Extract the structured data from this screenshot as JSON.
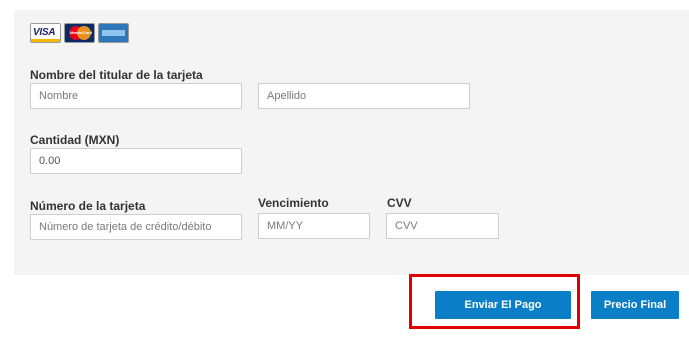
{
  "payment_cards": [
    "visa-icon",
    "mastercard-icon",
    "amex-icon"
  ],
  "card_labels": {
    "visa": "VISA",
    "mastercard": "MasterCard"
  },
  "cardholder": {
    "label": "Nombre del titular de la tarjeta",
    "first_name_placeholder": "Nombre",
    "last_name_placeholder": "Apellido"
  },
  "amount": {
    "label": "Cantidad (MXN)",
    "value": "0.00"
  },
  "card_number": {
    "label": "Número de la tarjeta",
    "placeholder": "Número de tarjeta de crédito/débito"
  },
  "expiration": {
    "label": "Vencimiento",
    "placeholder": "MM/YY"
  },
  "cvv": {
    "label": "CVV",
    "placeholder": "CVV"
  },
  "actions": {
    "send_payment": "Enviar El Pago",
    "final_price": "Precio Final"
  },
  "colors": {
    "button": "#0a7fc7",
    "highlight": "#e00000",
    "panel": "#f4f4f4"
  }
}
